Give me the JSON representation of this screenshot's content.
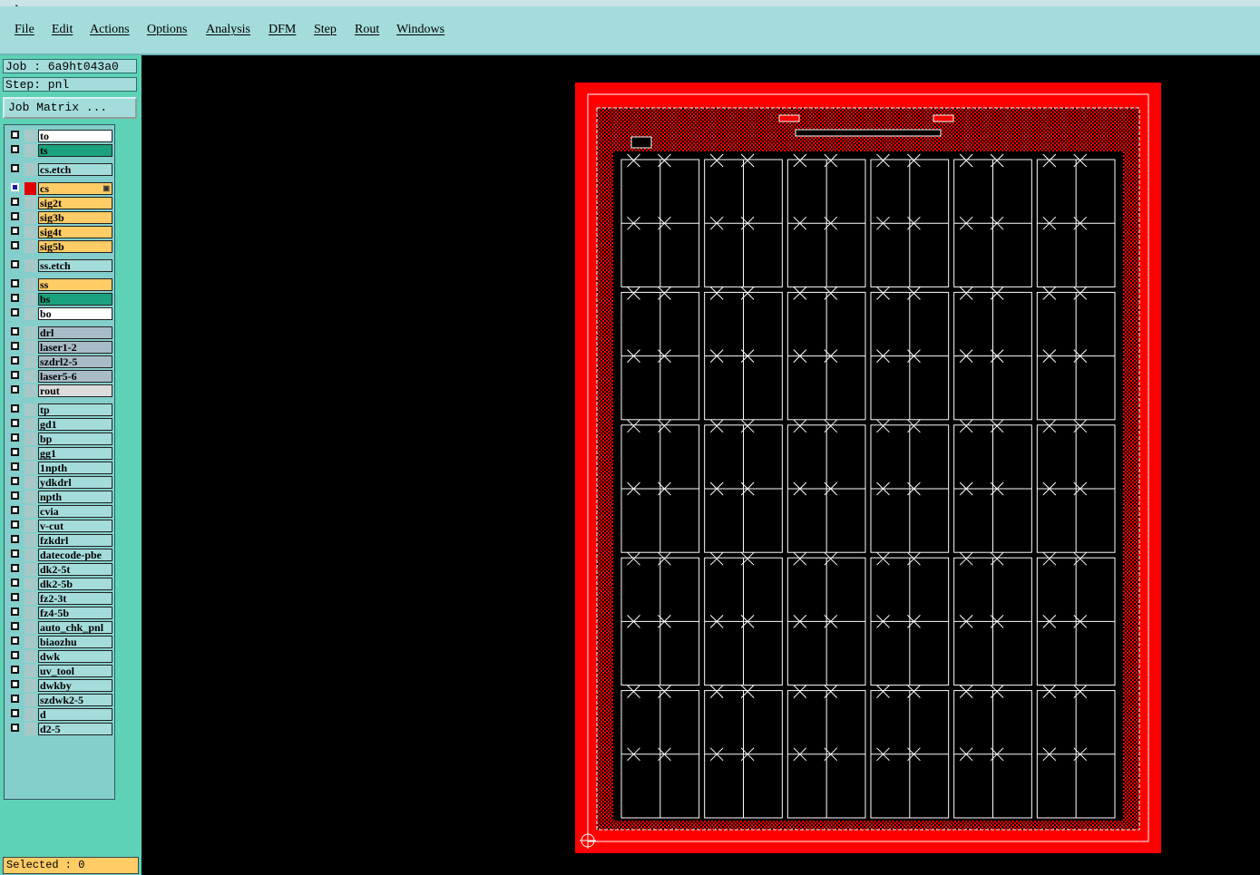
{
  "menu": {
    "items": [
      "File",
      "Edit",
      "Actions",
      "Options",
      "Analysis",
      "DFM",
      "Step",
      "Rout",
      "Windows"
    ]
  },
  "panel": {
    "job_label": "Job : 6a9ht043a0",
    "step_label": "Step: pnl",
    "job_matrix_label": "Job Matrix ...",
    "selected_label": "Selected : 0"
  },
  "layers": [
    {
      "name": "to",
      "color": "#ffffff"
    },
    {
      "name": "ts",
      "color": "#1aa27e"
    },
    {
      "name": "cs.etch",
      "color": "#a4dcdc"
    },
    {
      "name": "cs",
      "color": "#ffcc66",
      "selected": true,
      "work_layer_color": "#e00000"
    },
    {
      "name": "sig2t",
      "color": "#ffcc66"
    },
    {
      "name": "sig3b",
      "color": "#ffcc66"
    },
    {
      "name": "sig4t",
      "color": "#ffcc66"
    },
    {
      "name": "sig5b",
      "color": "#ffcc66"
    },
    {
      "name": "ss.etch",
      "color": "#a4dcdc"
    },
    {
      "name": "ss",
      "color": "#ffcc66"
    },
    {
      "name": "bs",
      "color": "#1aa27e"
    },
    {
      "name": "bo",
      "color": "#ffffff"
    },
    {
      "name": "drl",
      "color": "#a8bcc8"
    },
    {
      "name": "laser1-2",
      "color": "#a8bcc8"
    },
    {
      "name": "szdrl2-5",
      "color": "#a8bcc8"
    },
    {
      "name": "laser5-6",
      "color": "#a8bcc8"
    },
    {
      "name": "rout",
      "color": "#dcdcdc"
    },
    {
      "name": "tp",
      "color": "#a4dcdc"
    },
    {
      "name": "gd1",
      "color": "#a4dcdc"
    },
    {
      "name": "bp",
      "color": "#a4dcdc"
    },
    {
      "name": "gg1",
      "color": "#a4dcdc"
    },
    {
      "name": "1npth",
      "color": "#a4dcdc"
    },
    {
      "name": "ydkdrl",
      "color": "#a4dcdc"
    },
    {
      "name": "npth",
      "color": "#a4dcdc"
    },
    {
      "name": "cvia",
      "color": "#a4dcdc"
    },
    {
      "name": "v-cut",
      "color": "#a4dcdc"
    },
    {
      "name": "fzkdrl",
      "color": "#a4dcdc"
    },
    {
      "name": "datecode-pbe",
      "color": "#a4dcdc"
    },
    {
      "name": "dk2-5t",
      "color": "#a4dcdc"
    },
    {
      "name": "dk2-5b",
      "color": "#a4dcdc"
    },
    {
      "name": "fz2-3t",
      "color": "#a4dcdc"
    },
    {
      "name": "fz4-5b",
      "color": "#a4dcdc"
    },
    {
      "name": "auto_chk_pnl",
      "color": "#a4dcdc"
    },
    {
      "name": "biaozhu",
      "color": "#a4dcdc"
    },
    {
      "name": "dwk",
      "color": "#a4dcdc"
    },
    {
      "name": "uv_tool",
      "color": "#a4dcdc"
    },
    {
      "name": "dwkby",
      "color": "#a4dcdc"
    },
    {
      "name": "szdwk2-5",
      "color": "#a4dcdc"
    },
    {
      "name": "d",
      "color": "#a4dcdc"
    },
    {
      "name": "d2-5",
      "color": "#a4dcdc"
    }
  ],
  "graphics": {
    "board_color": "#ff0000",
    "line_color": "#ffffff",
    "unit_columns": 6,
    "unit_rows": 5
  }
}
